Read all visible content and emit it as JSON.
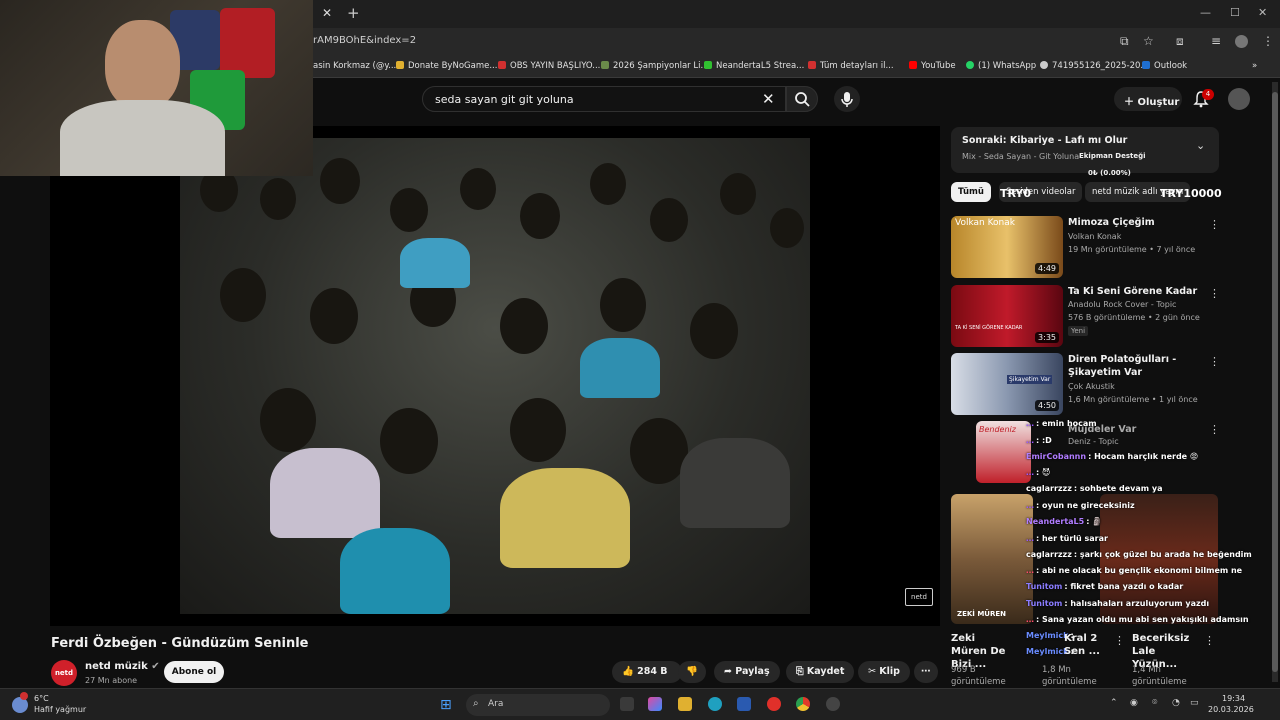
{
  "browser": {
    "url_fragment": "rAM9BOhE&index=2",
    "bookmarks": [
      {
        "label": "asin Korkmaz (@y...",
        "color": "#888888"
      },
      {
        "label": "Donate ByNoGame...",
        "color": "#e0b030"
      },
      {
        "label": "OBS YAYIN BAŞLIYO...",
        "color": "#d03030"
      },
      {
        "label": "2026 Şampiyonlar Li...",
        "color": "#6a8a4a"
      },
      {
        "label": "NeandertaL5 Strea...",
        "color": "#30c030"
      },
      {
        "label": "Tüm detayları il...",
        "color": "#d03030"
      },
      {
        "label": "YouTube",
        "color": "#ff0000"
      },
      {
        "label": "(1) WhatsApp",
        "color": "#25d366"
      },
      {
        "label": "741955126_2025-20...",
        "color": "#cccccc"
      },
      {
        "label": "Outlook",
        "color": "#1f6fd1"
      }
    ]
  },
  "header": {
    "search_query": "seda sayan git git yoluna",
    "create_label": "Oluştur",
    "notification_count": "4"
  },
  "video": {
    "title": "Ferdi Özbeğen - Gündüzüm Seninle",
    "channel_name": "netd müzik",
    "channel_subs": "27 Mn abone",
    "channel_avatar_text": "netd",
    "subscribe_label": "Abone ol",
    "like_count": "284 B",
    "share_label": "Paylaş",
    "save_label": "Kaydet",
    "clip_label": "Klip",
    "watermark": "netd"
  },
  "playlist": {
    "next_label": "Sonraki: Kibariye - Lafı mı Olur",
    "mix_label": "Mix - Seda Sayan - Git Yoluna",
    "overlay_support": "Ekipman Desteği",
    "overlay_progress": "0₺ (0.00%)",
    "overlay_left": "TRY0",
    "overlay_right": "TRY10000"
  },
  "chips": [
    "Tümü",
    "Seriden videolar",
    "netd müzik adlı yayın"
  ],
  "recommendations": [
    {
      "title": "Mimoza Çiçeğim",
      "channel": "Volkan Konak",
      "meta": "19 Mn görüntüleme • 7 yıl önce",
      "duration": "4:49",
      "thumb_text": "Volkan Konak"
    },
    {
      "title": "Ta Ki Seni Görene Kadar",
      "channel": "Anadolu Rock Cover - Topic",
      "meta": "576 B görüntüleme • 2 gün önce",
      "badge": "Yeni",
      "duration": "3:35",
      "thumb_text": "TA Kİ SENİ GÖRENE KADAR"
    },
    {
      "title": "Diren Polatoğulları - Şikayetim Var",
      "channel": "Çok Akustik",
      "meta": "1,6 Mn görüntüleme • 1 yıl önce",
      "duration": "4:50",
      "thumb_text": "Şikayetim Var"
    },
    {
      "title": "Müjdeler Var",
      "channel": "Deniz - Topic",
      "thumb_text": "Bendeniz"
    }
  ],
  "chat": [
    {
      "user": "…",
      "msg": ": emin hocam",
      "color": "#9b59ff"
    },
    {
      "user": "…",
      "msg": ": :D",
      "color": "#9b59ff"
    },
    {
      "user": "EmirCobannn",
      "msg": ": Hocam harçlık nerde 😡",
      "color": "#b07cff"
    },
    {
      "user": "…",
      "msg": ": 😈",
      "color": "#9b59ff"
    },
    {
      "user": "caglarrzzz",
      "msg": ": sohbete devam ya",
      "color": "#ffffff"
    },
    {
      "user": "…",
      "msg": ": oyun ne gireceksiniz",
      "color": "#9b59ff"
    },
    {
      "user": "NeandertaL5",
      "msg": ": 🗿",
      "color": "#b07cff"
    },
    {
      "user": "…",
      "msg": ": her türlü sarar",
      "color": "#9b59ff"
    },
    {
      "user": "caglarrzzz",
      "msg": ": şarkı çok güzel bu arada he beğendim",
      "color": "#ffffff"
    },
    {
      "user": "…",
      "msg": ": abi ne olacak bu gençlik ekonomi bilmem ne",
      "color": "#ff4d6d"
    },
    {
      "user": "Tunitom",
      "msg": ": fikret bana yazdı o kadar",
      "color": "#8a7cff"
    },
    {
      "user": "Tunitom",
      "msg": ": halısahaları arzuluyorum yazdı",
      "color": "#8a7cff"
    },
    {
      "user": "…",
      "msg": ": Sana yazan oldu mu abi sen yakışıklı adamsın",
      "color": "#ff4d6d"
    },
    {
      "user": "Meylmick",
      "msg": ": ",
      "color": "#6a8cff"
    },
    {
      "user": "Meylmick",
      "msg": ": ",
      "color": "#6a8cff"
    }
  ],
  "shorts": [
    {
      "title": "Zeki Müren De Bizi ...",
      "views": "969 B",
      "label": "görüntüleme"
    },
    {
      "title": "Kral 2 Sen ...",
      "views": "1,8 Mn",
      "label": "görüntüleme"
    },
    {
      "title": "Beceriksiz Lale Yüzün...",
      "views": "1,4 Mn",
      "label": "görüntüleme"
    }
  ],
  "shorts_thumb_text": "ZEKİ MÜREN",
  "taskbar": {
    "temp": "6°C",
    "weather": "Hafif yağmur",
    "search_placeholder": "Ara",
    "time": "19:34",
    "date": "20.03.2026"
  }
}
